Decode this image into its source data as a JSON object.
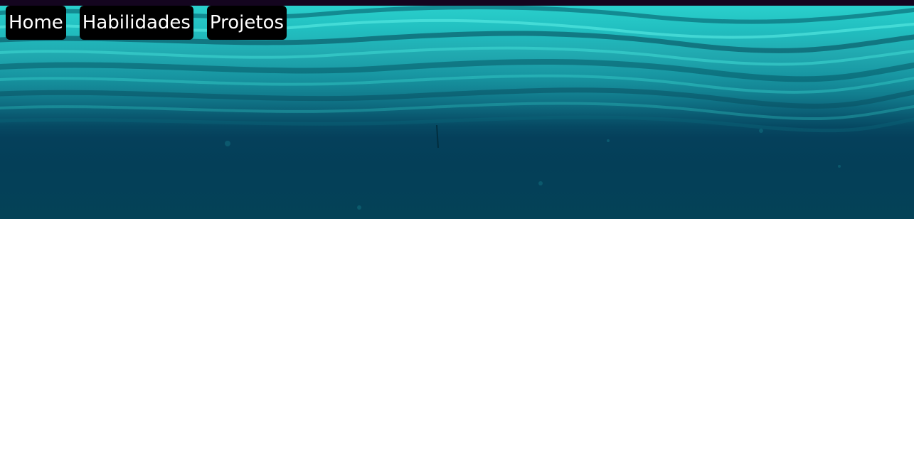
{
  "nav": {
    "items": [
      {
        "label": "Home"
      },
      {
        "label": "Habilidades"
      },
      {
        "label": "Projetos"
      }
    ]
  },
  "colors": {
    "top_strip": "#14051f",
    "nav_button_bg": "#000000",
    "nav_button_text": "#ffffff",
    "water_light": "#0fb3b3",
    "water_deep": "#044257",
    "page_bg": "#ffffff"
  },
  "hero": {
    "image": "underwater-ocean-surface"
  }
}
